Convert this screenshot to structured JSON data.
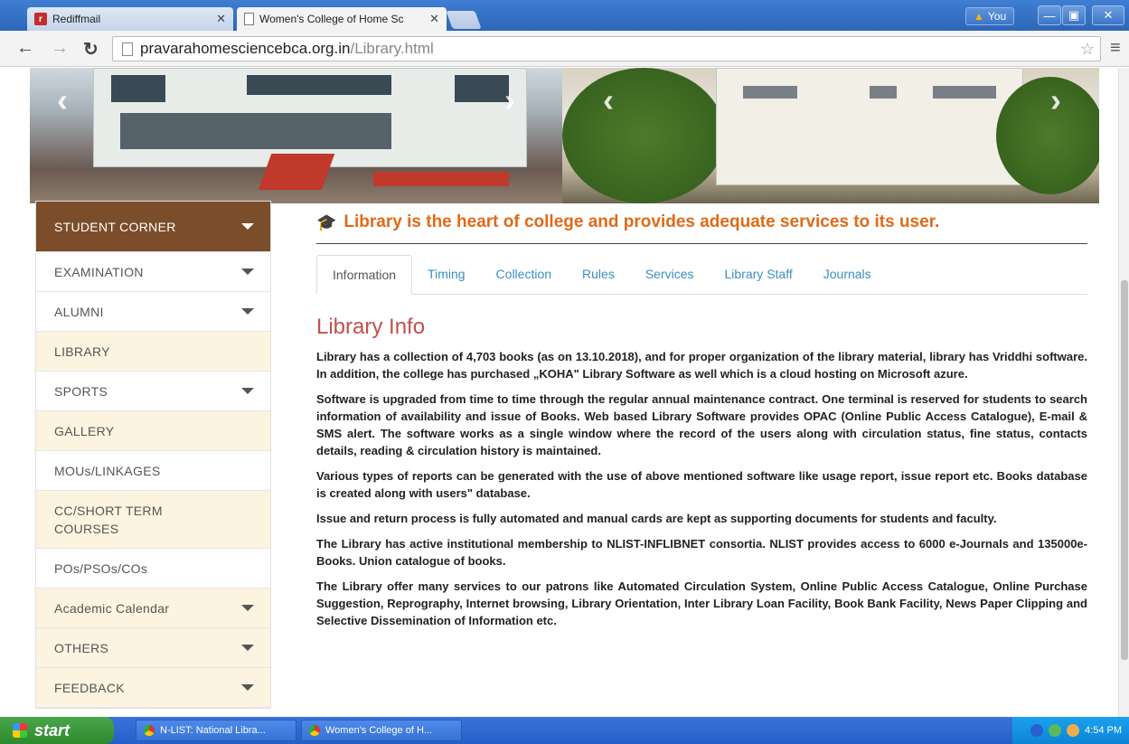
{
  "browser": {
    "tabs": [
      {
        "title": "Rediffmail",
        "active": false
      },
      {
        "title": "Women's College of Home Sc",
        "active": true
      }
    ],
    "user": "You",
    "url_host": "pravarahomesciencebca.org.in",
    "url_path": "/Library.html",
    "window_controls": {
      "minimize": "—",
      "maximize": "▣",
      "close": "✕"
    }
  },
  "sidebar": {
    "items": [
      {
        "label": "STUDENT CORNER"
      },
      {
        "label": "EXAMINATION"
      },
      {
        "label": "ALUMNI"
      },
      {
        "label": "LIBRARY"
      },
      {
        "label": "SPORTS"
      },
      {
        "label": "GALLERY"
      },
      {
        "label": "MOUs/LINKAGES"
      },
      {
        "label": "CC/SHORT TERM COURSES"
      },
      {
        "label": "POs/PSOs/COs"
      },
      {
        "label": "Academic Calendar"
      },
      {
        "label": "OTHERS"
      },
      {
        "label": "FEEDBACK"
      }
    ]
  },
  "content": {
    "headline": "Library is the heart of college and provides adequate services to its user.",
    "tabs": [
      "Information",
      "Timing",
      "Collection",
      "Rules",
      "Services",
      "Library Staff",
      "Journals"
    ],
    "section_title": "Library Info",
    "paragraphs": [
      "Library has a collection of 4,703 books (as on 13.10.2018), and for proper organization of the library material, library has Vriddhi software. In addition, the college has purchased „KOHA\" Library Software as well which is a cloud hosting on Microsoft azure.",
      "Software is upgraded from time to time through the regular annual maintenance contract. One terminal is reserved for students to search information of availability and issue of Books. Web based Library Software provides OPAC (Online Public Access Catalogue), E-mail & SMS alert. The software works as a single window where the record of the users along with circulation status, fine status, contacts details, reading & circulation history is maintained.",
      "Various types of reports can be generated with the use of above mentioned software like usage report, issue report etc. Books database is created along with users\" database.",
      "Issue and return process is fully automated and manual cards are kept as supporting documents for students and faculty.",
      "The Library has active institutional membership to NLIST-INFLIBNET consortia. NLIST provides access to 6000 e-Journals and 135000e-Books. Union catalogue of books.",
      "The Library offer many services to our patrons like Automated Circulation System, Online Public Access Catalogue, Online Purchase Suggestion, Reprography, Internet browsing, Library Orientation, Inter Library Loan Facility, Book Bank Facility, News Paper Clipping and Selective Dissemination of Information etc."
    ]
  },
  "taskbar": {
    "start": "start",
    "tasks": [
      "N-LIST: National Libra...",
      "Women's College of H..."
    ],
    "clock": "4:54 PM"
  },
  "colors": {
    "accent_orange": "#e06a18",
    "active_menu": "#7b4d2a",
    "highlight_menu": "#fcf4e0",
    "link_blue": "#3a8ec4",
    "section_red": "#c0504d"
  }
}
